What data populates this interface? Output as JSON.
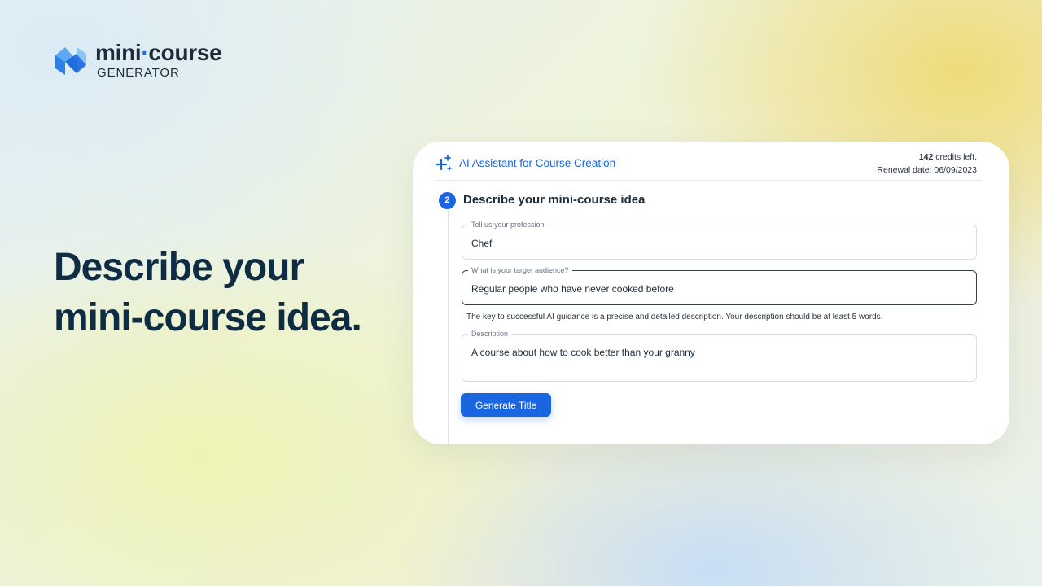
{
  "brand": {
    "name_part1": "mini",
    "name_dot": "·",
    "name_part2": "course",
    "subtitle": "GENERATOR"
  },
  "headline": {
    "line1": "Describe your",
    "line2": "mini-course idea."
  },
  "card": {
    "assistant_title": "AI Assistant for Course Creation",
    "credits_count": "142",
    "credits_suffix": " credits left.",
    "renewal": "Renewal date: 06/09/2023",
    "step_number": "2",
    "step_title": "Describe your mini-course idea",
    "fields": [
      {
        "label": "Tell us your profession",
        "value": "Chef"
      },
      {
        "label": "What is your target audience?",
        "value": "Regular people who have never cooked before"
      },
      {
        "label": "Description",
        "value": "A course about how to cook better than your granny"
      }
    ],
    "hint": "The key to successful AI guidance is a precise and detailed description. Your description should be at least 5 words.",
    "button_label": "Generate Title"
  },
  "icons": {
    "logo": "logo-mark-icon",
    "assistant": "sparkle-icon"
  },
  "colors": {
    "accent": "#1a66e0",
    "headline": "#0f2c45",
    "brand_text": "#1e2c3a"
  }
}
